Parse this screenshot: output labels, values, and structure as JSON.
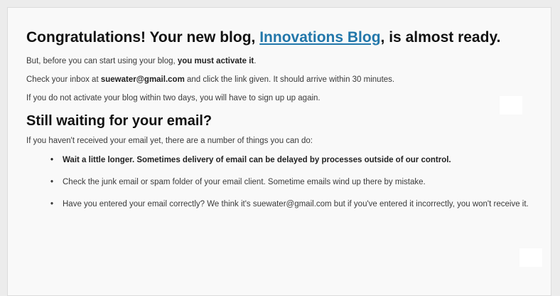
{
  "signup": {
    "title_prefix": "Congratulations! Your new blog, ",
    "blog_name": "Innovations Blog",
    "title_suffix": ", is almost ready.",
    "activate_prefix": "But, before you can start using your blog, ",
    "activate_bold": "you must activate it",
    "activate_suffix": ".",
    "inbox_prefix": "Check your inbox at ",
    "email": "suewater@gmail.com",
    "inbox_suffix": " and click the link given. It should arrive within 30 minutes.",
    "two_days_notice": "If you do not activate your blog within two days, you will have to sign up up again."
  },
  "waiting": {
    "heading": "Still waiting for your email?",
    "intro": "If you haven't received your email yet, there are a number of things you can do:",
    "bullet": "•",
    "tips": [
      "Wait a little longer. Sometimes delivery of email can be delayed by processes outside of our control.",
      "Check the junk email or spam folder of your email client. Sometime emails wind up there by mistake.",
      "Have you entered your email correctly? We think it's suewater@gmail.com but if you've entered it incorrectly, you won't receive it."
    ]
  }
}
